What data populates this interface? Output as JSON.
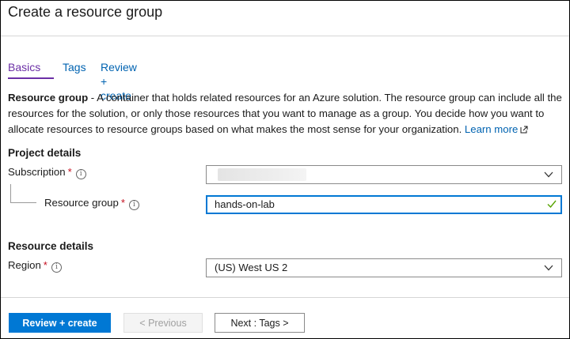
{
  "page": {
    "title": "Create a resource group"
  },
  "tabs": [
    {
      "label": "Basics",
      "active": true
    },
    {
      "label": "Tags",
      "active": false
    },
    {
      "label": "Review + create",
      "active": false
    }
  ],
  "description": {
    "bold_term": "Resource group",
    "text": " - A container that holds related resources for an Azure solution. The resource group can include all the resources for the solution, or only those resources that you want to manage as a group. You decide how you want to allocate resources to resource groups based on what makes the most sense for your organization. ",
    "learn_more": "Learn more"
  },
  "project_details": {
    "heading": "Project details",
    "subscription": {
      "label": "Subscription",
      "required_mark": "*",
      "value": ""
    },
    "resource_group": {
      "label": "Resource group",
      "required_mark": "*",
      "value": "hands-on-lab",
      "valid": true
    }
  },
  "resource_details": {
    "heading": "Resource details",
    "region": {
      "label": "Region",
      "required_mark": "*",
      "value": "(US) West US 2"
    }
  },
  "footer": {
    "review_create": "Review + create",
    "previous": "< Previous",
    "next": "Next : Tags >"
  },
  "icons": {
    "info": "i",
    "chevron": "chevron-down-icon",
    "check": "check-icon",
    "external": "external-link-icon"
  },
  "colors": {
    "accent": "#0078d4",
    "link": "#0063b1",
    "active_tab": "#6b2fa6",
    "required": "#c50f1f",
    "valid_check": "#57a300"
  }
}
